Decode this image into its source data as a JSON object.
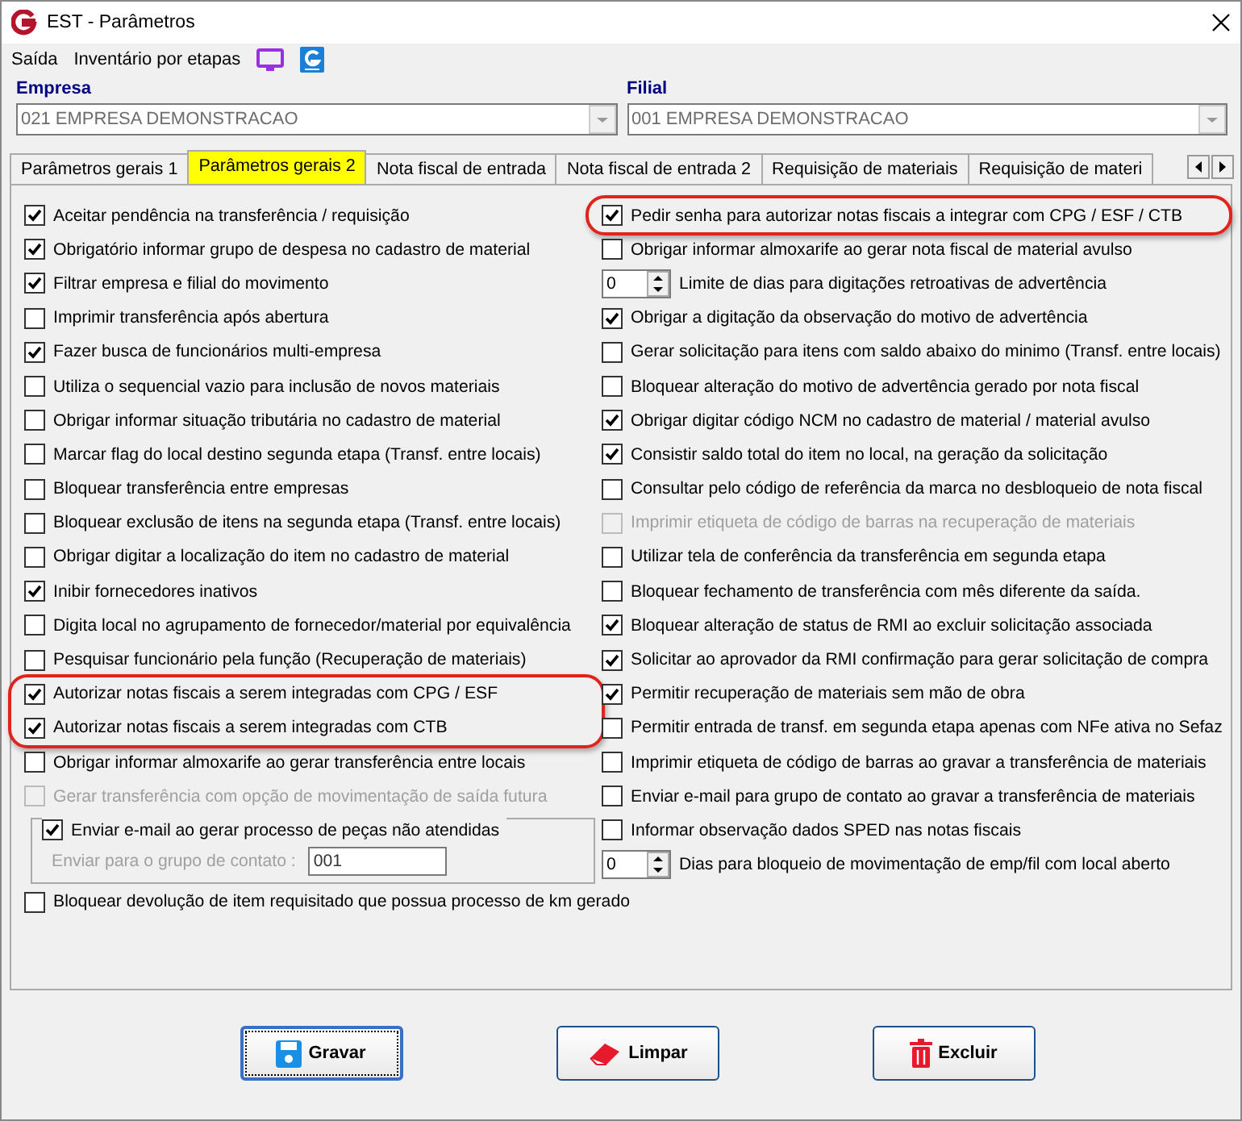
{
  "window": {
    "title": "EST - Parâmetros"
  },
  "menu": [
    {
      "kind": "text",
      "label": "Saída"
    },
    {
      "kind": "text",
      "label": "Inventário por etapas"
    },
    {
      "kind": "monitor"
    },
    {
      "kind": "logo"
    }
  ],
  "empresa": {
    "label": "Empresa",
    "value": "021 EMPRESA DEMONSTRACAO"
  },
  "filial": {
    "label": "Filial",
    "value": "001 EMPRESA DEMONSTRACAO"
  },
  "tabs": [
    {
      "label": "Parâmetros gerais 1",
      "selected": false
    },
    {
      "label": "Parâmetros gerais 2",
      "selected": true
    },
    {
      "label": "Nota fiscal de entrada",
      "selected": false
    },
    {
      "label": "Nota fiscal de entrada 2",
      "selected": false
    },
    {
      "label": "Requisição de materiais",
      "selected": false
    },
    {
      "label": "Requisição de materi",
      "selected": false
    }
  ],
  "left_column": [
    {
      "kind": "check",
      "label": "Aceitar pendência na transferência / requisição",
      "checked": true,
      "disabled": false
    },
    {
      "kind": "check",
      "label": "Obrigatório informar grupo de despesa no cadastro de material",
      "checked": true,
      "disabled": false
    },
    {
      "kind": "check",
      "label": "Filtrar empresa e filial do movimento",
      "checked": true,
      "disabled": false
    },
    {
      "kind": "check",
      "label": "Imprimir transferência após abertura",
      "checked": false,
      "disabled": false
    },
    {
      "kind": "check",
      "label": "Fazer busca de funcionários multi-empresa",
      "checked": true,
      "disabled": false
    },
    {
      "kind": "check",
      "label": "Utiliza o sequencial vazio para inclusão de novos materiais",
      "checked": false,
      "disabled": false
    },
    {
      "kind": "check",
      "label": "Obrigar informar situação tributária no cadastro de material",
      "checked": false,
      "disabled": false
    },
    {
      "kind": "check",
      "label": "Marcar flag do local destino segunda etapa (Transf. entre locais)",
      "checked": false,
      "disabled": false
    },
    {
      "kind": "check",
      "label": "Bloquear transferência entre empresas",
      "checked": false,
      "disabled": false
    },
    {
      "kind": "check",
      "label": "Bloquear exclusão de itens na segunda etapa (Transf. entre locais)",
      "checked": false,
      "disabled": false
    },
    {
      "kind": "check",
      "label": "Obrigar digitar a localização do item no cadastro de material",
      "checked": false,
      "disabled": false
    },
    {
      "kind": "check",
      "label": "Inibir fornecedores inativos",
      "checked": true,
      "disabled": false
    },
    {
      "kind": "check",
      "label": "Digita local no agrupamento de fornecedor/material por equivalência",
      "checked": false,
      "disabled": false
    },
    {
      "kind": "check",
      "label": "Pesquisar funcionário pela função (Recuperação de materiais)",
      "checked": false,
      "disabled": false
    },
    {
      "kind": "callout",
      "items": [
        {
          "kind": "check",
          "label": "Autorizar notas fiscais a serem integradas com CPG / ESF",
          "checked": true,
          "disabled": false
        },
        {
          "kind": "check",
          "label": "Autorizar notas fiscais a serem integradas com CTB",
          "checked": true,
          "disabled": false
        }
      ]
    },
    {
      "kind": "check",
      "label": "Obrigar informar almoxarife ao gerar transferência entre locais",
      "checked": false,
      "disabled": false
    },
    {
      "kind": "check",
      "label": "Gerar transferência com opção de movimentação de saída futura",
      "checked": false,
      "disabled": true
    },
    {
      "kind": "group",
      "label": "Enviar e-mail ao gerar processo de peças não atendidas",
      "checked": true,
      "field_label": "Enviar para o grupo de contato :",
      "field_value": "001"
    }
  ],
  "right_column": [
    {
      "kind": "callout",
      "items": [
        {
          "kind": "check",
          "label": "Pedir senha para autorizar notas fiscais a integrar com CPG / ESF / CTB",
          "checked": true,
          "disabled": false
        }
      ]
    },
    {
      "kind": "check",
      "label": "Obrigar informar almoxarife ao gerar nota fiscal de material avulso",
      "checked": false,
      "disabled": false
    },
    {
      "kind": "spin",
      "label": "Limite de dias para digitações retroativas de advertência",
      "spin_value": "0"
    },
    {
      "kind": "check",
      "label": "Obrigar a digitação da observação do motivo de advertência",
      "checked": true,
      "disabled": false
    },
    {
      "kind": "check",
      "label": "Gerar solicitação para itens com saldo abaixo do minimo (Transf. entre locais)",
      "checked": false,
      "disabled": false
    },
    {
      "kind": "check",
      "label": "Bloquear alteração do motivo de advertência gerado por nota fiscal",
      "checked": false,
      "disabled": false
    },
    {
      "kind": "check",
      "label": "Obrigar digitar código NCM no cadastro de material / material avulso",
      "checked": true,
      "disabled": false
    },
    {
      "kind": "check",
      "label": "Consistir saldo total do item no local, na geração da solicitação",
      "checked": true,
      "disabled": false
    },
    {
      "kind": "check",
      "label": "Consultar pelo código de referência da marca no desbloqueio de nota fiscal",
      "checked": false,
      "disabled": false
    },
    {
      "kind": "check",
      "label": "Imprimir etiqueta de código de barras na recuperação de materiais",
      "checked": false,
      "disabled": true
    },
    {
      "kind": "check",
      "label": "Utilizar tela de conferência da transferência em segunda etapa",
      "checked": false,
      "disabled": false
    },
    {
      "kind": "check",
      "label": "Bloquear fechamento de transferência com mês diferente da saída.",
      "checked": false,
      "disabled": false
    },
    {
      "kind": "check",
      "label": "Bloquear alteração de status de RMI ao excluir solicitação associada",
      "checked": true,
      "disabled": false
    },
    {
      "kind": "check",
      "label": "Solicitar ao aprovador da RMI confirmação para gerar solicitação de compra",
      "checked": true,
      "disabled": false
    },
    {
      "kind": "check",
      "label": "Permitir recuperação de materiais sem mão de obra",
      "checked": true,
      "disabled": false
    },
    {
      "kind": "check",
      "label": "Permitir entrada de transf. em segunda etapa apenas com NFe ativa no Sefaz",
      "checked": false,
      "disabled": false
    },
    {
      "kind": "check",
      "label": "Imprimir etiqueta de código de barras ao gravar a transferência de materiais",
      "checked": false,
      "disabled": false
    },
    {
      "kind": "check",
      "label": "Enviar e-mail para grupo de contato ao gravar a transferência de materiais",
      "checked": false,
      "disabled": false
    },
    {
      "kind": "check",
      "label": "Informar observação dados SPED nas notas fiscais",
      "checked": false,
      "disabled": false
    },
    {
      "kind": "spin",
      "label": "Dias para bloqueio de movimentação de emp/fil com local aberto",
      "spin_value": "0"
    }
  ],
  "bottom_rows": [
    {
      "kind": "check",
      "label": "Bloquear devolução de item requisitado que possua processo de km gerado",
      "checked": false,
      "disabled": false
    }
  ],
  "buttons": [
    {
      "kind": "save",
      "label": "Gravar",
      "focused": true
    },
    {
      "kind": "clear",
      "label": "Limpar",
      "focused": false
    },
    {
      "kind": "delete",
      "label": "Excluir",
      "focused": false
    }
  ]
}
